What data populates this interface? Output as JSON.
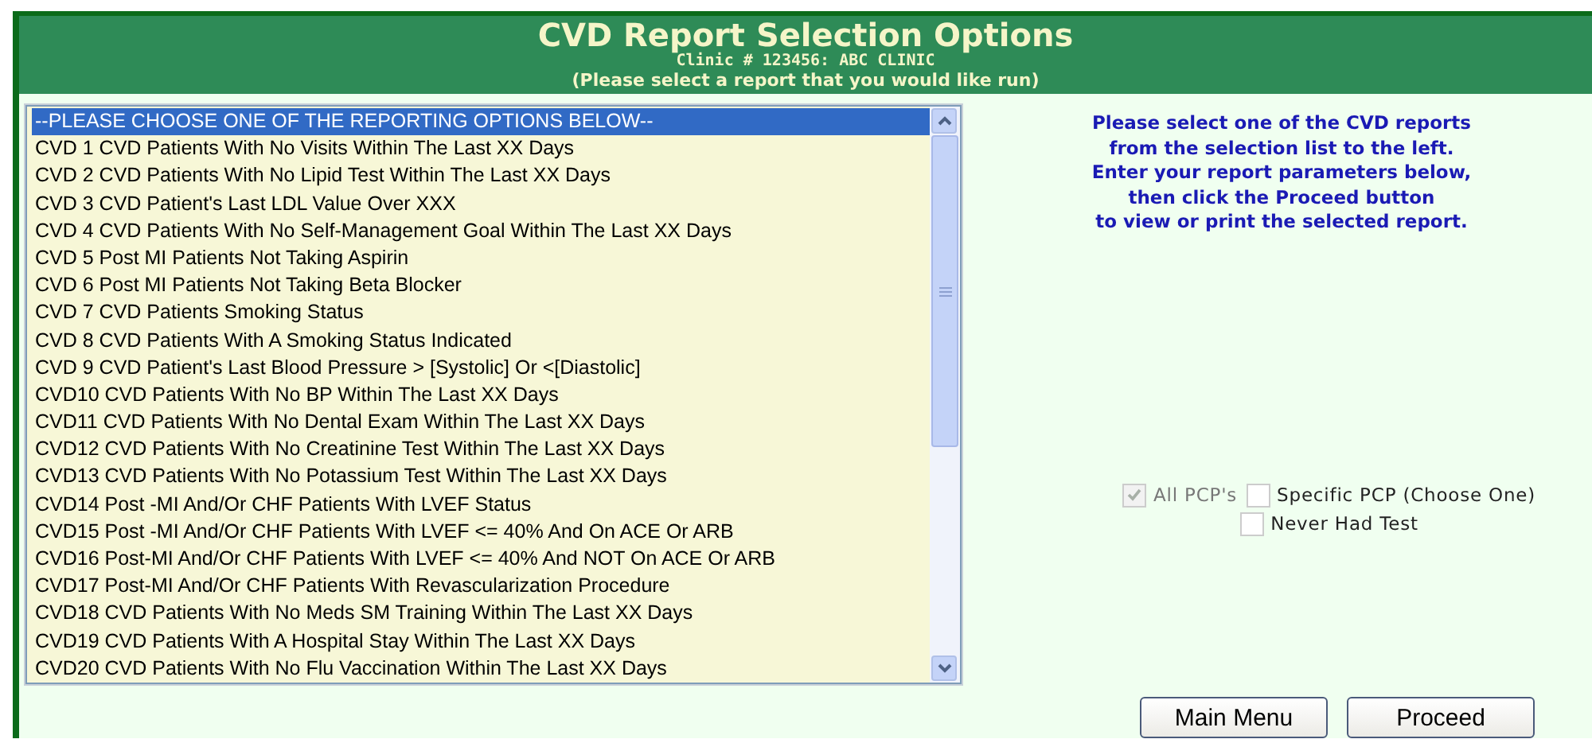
{
  "header": {
    "title": "CVD Report Selection Options",
    "clinic": "Clinic # 123456: ABC CLINIC",
    "instruction": "(Please select a report that you would like run)"
  },
  "report_list": {
    "options": [
      {
        "label": "--PLEASE CHOOSE ONE OF THE REPORTING OPTIONS BELOW--",
        "selected": true
      },
      {
        "label": "CVD 1 CVD Patients With No Visits Within The Last XX Days",
        "selected": false
      },
      {
        "label": "CVD 2 CVD Patients With No Lipid Test Within The Last XX Days",
        "selected": false
      },
      {
        "label": "CVD 3 CVD Patient's Last LDL Value Over XXX",
        "selected": false
      },
      {
        "label": "CVD 4 CVD Patients With No Self-Management Goal Within The Last XX Days",
        "selected": false
      },
      {
        "label": "CVD 5 Post MI Patients Not Taking Aspirin",
        "selected": false
      },
      {
        "label": "CVD 6 Post MI Patients Not Taking Beta Blocker",
        "selected": false
      },
      {
        "label": "CVD 7 CVD Patients Smoking Status",
        "selected": false
      },
      {
        "label": "CVD 8 CVD Patients With A Smoking Status Indicated",
        "selected": false
      },
      {
        "label": "CVD 9 CVD Patient's Last Blood Pressure > [Systolic] Or <[Diastolic]",
        "selected": false
      },
      {
        "label": "CVD10 CVD Patients With No BP Within The Last XX Days",
        "selected": false
      },
      {
        "label": "CVD11 CVD Patients With No Dental Exam Within The Last XX Days",
        "selected": false
      },
      {
        "label": "CVD12 CVD Patients With No Creatinine Test Within The Last XX Days",
        "selected": false
      },
      {
        "label": "CVD13 CVD Patients With No Potassium Test Within The Last XX Days",
        "selected": false
      },
      {
        "label": "CVD14 Post -MI And/Or CHF Patients With LVEF Status",
        "selected": false
      },
      {
        "label": "CVD15 Post -MI And/Or CHF Patients With LVEF <= 40% And On ACE Or ARB",
        "selected": false
      },
      {
        "label": "CVD16 Post-MI And/Or CHF Patients With LVEF <= 40% And NOT On ACE Or ARB",
        "selected": false
      },
      {
        "label": "CVD17 Post-MI And/Or CHF Patients With Revascularization Procedure",
        "selected": false
      },
      {
        "label": "CVD18 CVD Patients With No Meds SM Training Within The Last XX Days",
        "selected": false
      },
      {
        "label": "CVD19 CVD Patients With A Hospital Stay Within The Last XX Days",
        "selected": false
      },
      {
        "label": "CVD20 CVD Patients With No Flu Vaccination Within The Last XX Days",
        "selected": false
      }
    ]
  },
  "help_text": [
    "Please select one of the CVD reports",
    "from the selection list to the left.",
    "Enter your report parameters below,",
    "then click the Proceed button",
    "to view or print the selected report."
  ],
  "filter_rows": [
    [
      {
        "label": "All PCP's",
        "checked": true,
        "disabled": true
      },
      {
        "label": "Specific PCP (Choose One)",
        "checked": false,
        "disabled": false
      }
    ],
    [
      {
        "label": "Never Had Test",
        "checked": false,
        "disabled": false
      }
    ]
  ],
  "buttons": [
    "Main Menu",
    "Proceed"
  ]
}
